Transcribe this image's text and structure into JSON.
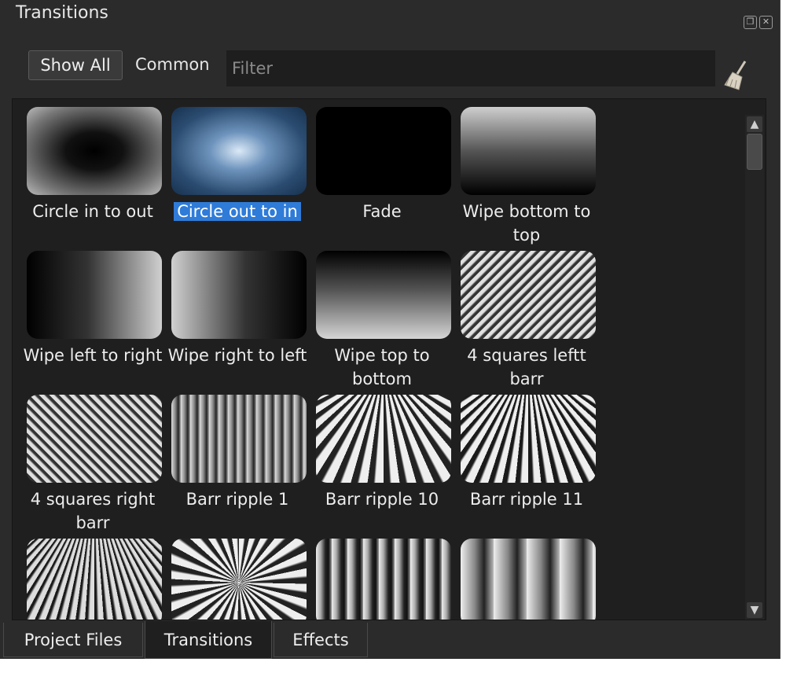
{
  "window": {
    "title": "Transitions",
    "float_icon": "restore-icon",
    "close_icon": "close-icon"
  },
  "toolbar": {
    "show_all_label": "Show All",
    "common_label": "Common",
    "filter_placeholder": "Filter",
    "filter_value": "",
    "clear_icon": "broom-icon"
  },
  "transitions": [
    {
      "label": "Circle in to out",
      "thumb": "radial-dark"
    },
    {
      "label": "Circle out to in",
      "thumb": "radial-blue",
      "selected": true
    },
    {
      "label": "Fade",
      "thumb": "black"
    },
    {
      "label": "Wipe bottom to top",
      "thumb": "grad-down"
    },
    {
      "label": "Wipe left to right",
      "thumb": "grad-right"
    },
    {
      "label": "Wipe right to left",
      "thumb": "grad-left"
    },
    {
      "label": "Wipe top to bottom",
      "thumb": "grad-up"
    },
    {
      "label": "4 squares leftt barr",
      "thumb": "stripes-right"
    },
    {
      "label": "4 squares right barr",
      "thumb": "stripes-left"
    },
    {
      "label": "Barr ripple 1",
      "thumb": "ripple-vert"
    },
    {
      "label": "Barr ripple 10",
      "thumb": "ripple-persp"
    },
    {
      "label": "Barr ripple 11",
      "thumb": "ripple-persp2"
    },
    {
      "label": "",
      "thumb": "ripple-persp3"
    },
    {
      "label": "",
      "thumb": "ripple-radial"
    },
    {
      "label": "",
      "thumb": "ripple-bars"
    },
    {
      "label": "",
      "thumb": "ripple-soft"
    }
  ],
  "tabs": [
    {
      "label": "Project Files",
      "active": false
    },
    {
      "label": "Transitions",
      "active": true
    },
    {
      "label": "Effects",
      "active": false
    }
  ],
  "colors": {
    "selection": "#2f7bd8",
    "panel_bg": "#2b2b2b",
    "list_bg": "#1f1f1f"
  }
}
